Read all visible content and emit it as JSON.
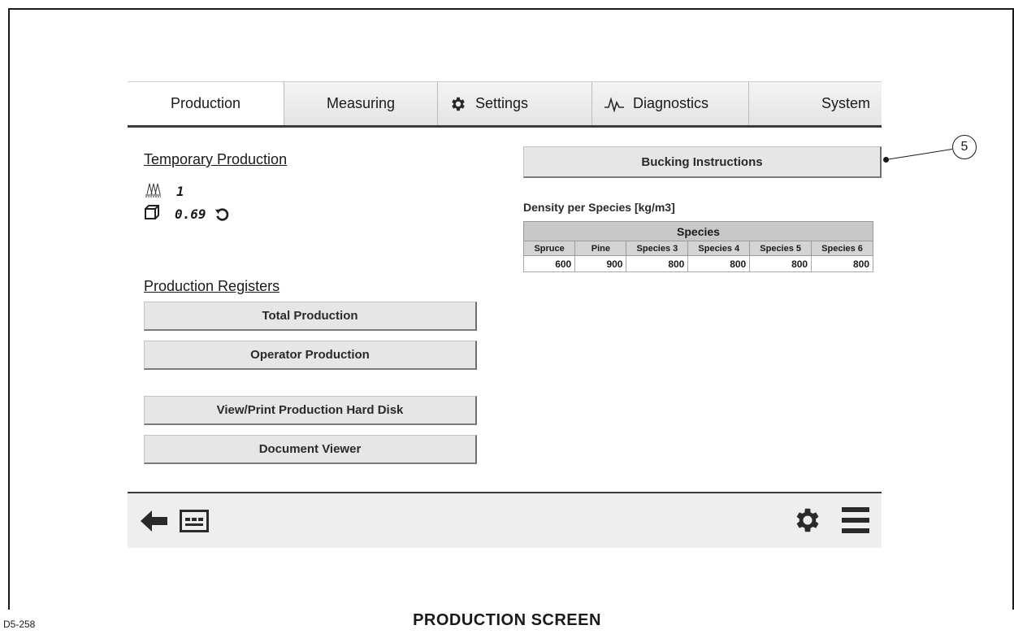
{
  "tabs": [
    {
      "label": "Production",
      "icon": null,
      "active": true
    },
    {
      "label": "Measuring",
      "icon": null,
      "active": false
    },
    {
      "label": "Settings",
      "icon": "gear-icon",
      "active": false
    },
    {
      "label": "Diagnostics",
      "icon": "waveform-icon",
      "active": false
    },
    {
      "label": "System",
      "icon": null,
      "active": false
    }
  ],
  "temporary_production": {
    "title": "Temporary Production",
    "trees_count": "1",
    "volume": "0.69"
  },
  "production_registers": {
    "title": "Production Registers",
    "total_label": "Total Production",
    "operator_label": "Operator Production",
    "view_print_label": "View/Print Production Hard Disk",
    "document_viewer_label": "Document Viewer"
  },
  "bucking_label": "Bucking Instructions",
  "density": {
    "label": "Density per Species [kg/m3]",
    "group_header": "Species",
    "columns": [
      "Spruce",
      "Pine",
      "Species 3",
      "Species 4",
      "Species 5",
      "Species 6"
    ],
    "values": [
      "600",
      "900",
      "800",
      "800",
      "800",
      "800"
    ]
  },
  "callout": "5",
  "caption": "PRODUCTION  SCREEN",
  "figure_ref": "D5-258",
  "colors": {
    "tab_bg": "#eeeeee",
    "button_bg": "#e6e6e6",
    "table_header": "#c8c8c8",
    "divider": "#3b3b3b"
  }
}
